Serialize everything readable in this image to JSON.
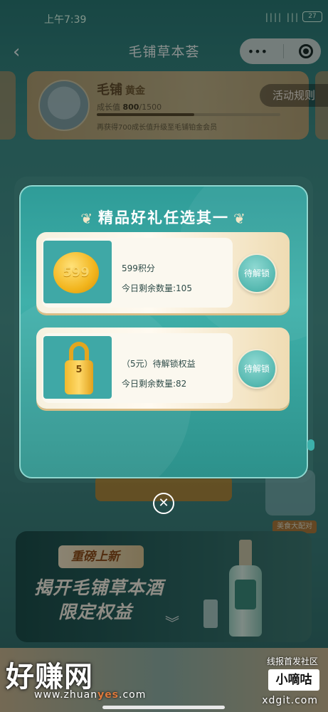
{
  "status_bar": {
    "time": "上午7:39",
    "signal": "|||| ||| ",
    "battery": "27"
  },
  "nav": {
    "back": "‹",
    "title": "毛铺草本荟",
    "more": "•••",
    "target": "◎"
  },
  "member_card": {
    "brand": "毛铺",
    "level": "黄金",
    "growth_label": "成长值",
    "growth_current": "800",
    "growth_total": "/1500",
    "progress": 0.53,
    "tip": "再获得700成长值升级至毛铺铂金会员"
  },
  "activity_rules": "活动规则",
  "modal": {
    "title": "精品好礼任选其一",
    "rewards": [
      {
        "icon": "coin-icon",
        "icon_text": "599",
        "name": "599积分",
        "remain": "今日剩余数量:105",
        "button": "待解锁"
      },
      {
        "icon": "lock-icon",
        "icon_text": "5",
        "name": "（5元）待解锁权益",
        "remain": "今日剩余数量:82",
        "button": "待解锁"
      }
    ]
  },
  "close_icon": "✕",
  "food_tag": "美食大配对",
  "banner": {
    "tag": "重磅上新",
    "line1": "揭开毛铺草本酒",
    "line2": "限定权益",
    "chevrons": "︾"
  },
  "watermark": {
    "left_title": "好赚网",
    "url_a": "www.zhuan",
    "url_b": "yes",
    "url_c": ".com",
    "right_top": "线报首发社区",
    "right_box": "小嘀咕",
    "right_bottom": "xdgit.com"
  },
  "colors": {
    "accent": "#3fb0aa",
    "gold": "#d7ba8a",
    "button": "#55b8b0"
  }
}
